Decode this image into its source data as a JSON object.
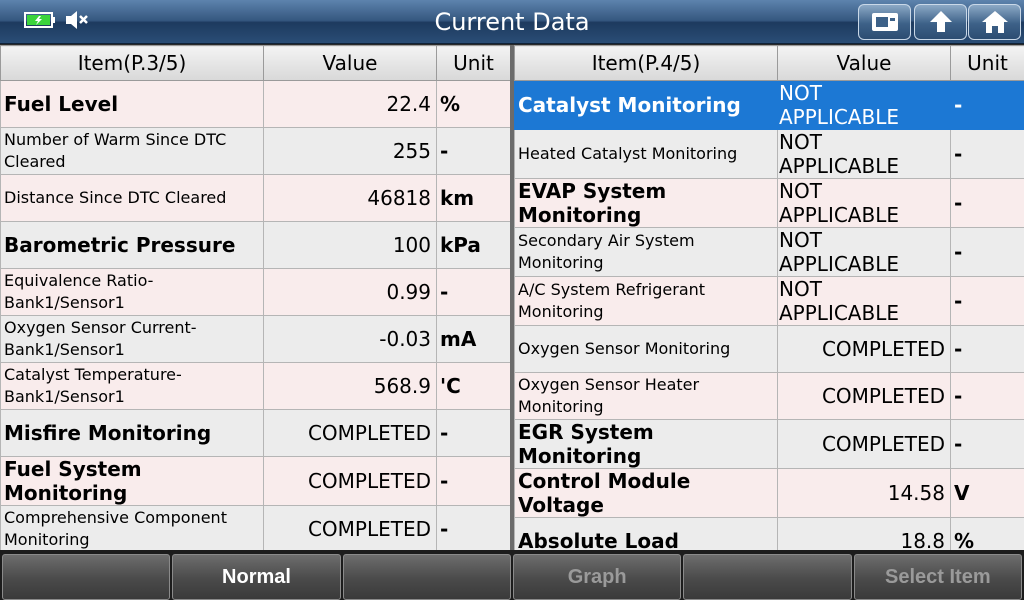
{
  "title": "Current Data",
  "left_table": {
    "headers": {
      "item": "Item(P.3/5)",
      "value": "Value",
      "unit": "Unit"
    },
    "rows": [
      {
        "item": "Fuel Level",
        "value": "22.4",
        "unit": "%",
        "style": "big"
      },
      {
        "item": "Number of Warm Since DTC Cleared",
        "value": "255",
        "unit": "-",
        "style": "small"
      },
      {
        "item": "Distance Since DTC Cleared",
        "value": "46818",
        "unit": "km",
        "style": "small"
      },
      {
        "item": "Barometric Pressure",
        "value": "100",
        "unit": "kPa",
        "style": "big"
      },
      {
        "item": "Equivalence Ratio-Bank1/Sensor1",
        "value": "0.99",
        "unit": "-",
        "style": "small"
      },
      {
        "item": "Oxygen Sensor Current-Bank1/Sensor1",
        "value": "-0.03",
        "unit": "mA",
        "style": "small"
      },
      {
        "item": "Catalyst Temperature-Bank1/Sensor1",
        "value": "568.9",
        "unit": "'C",
        "style": "small"
      },
      {
        "item": "Misfire Monitoring",
        "value": "COMPLETED",
        "unit": "-",
        "style": "big"
      },
      {
        "item": "Fuel System Monitoring",
        "value": "COMPLETED",
        "unit": "-",
        "style": "big"
      },
      {
        "item": "Comprehensive Component Monitoring",
        "value": "COMPLETED",
        "unit": "-",
        "style": "small"
      }
    ]
  },
  "right_table": {
    "headers": {
      "item": "Item(P.4/5)",
      "value": "Value",
      "unit": "Unit"
    },
    "rows": [
      {
        "item": "Catalyst Monitoring",
        "value": "NOT APPLICABLE",
        "unit": "-",
        "style": "big"
      },
      {
        "item": "Heated Catalyst Monitoring",
        "value": "NOT APPLICABLE",
        "unit": "-",
        "style": "small"
      },
      {
        "item": "EVAP System Monitoring",
        "value": "NOT APPLICABLE",
        "unit": "-",
        "style": "big"
      },
      {
        "item": "Secondary Air System Monitoring",
        "value": "NOT APPLICABLE",
        "unit": "-",
        "style": "small"
      },
      {
        "item": "A/C System Refrigerant Monitoring",
        "value": "NOT APPLICABLE",
        "unit": "-",
        "style": "small"
      },
      {
        "item": "Oxygen Sensor Monitoring",
        "value": "COMPLETED",
        "unit": "-",
        "style": "small"
      },
      {
        "item": "Oxygen Sensor Heater Monitoring",
        "value": "COMPLETED",
        "unit": "-",
        "style": "small"
      },
      {
        "item": "EGR System Monitoring",
        "value": "COMPLETED",
        "unit": "-",
        "style": "big"
      },
      {
        "item": "Control Module Voltage",
        "value": "14.58",
        "unit": "V",
        "style": "big"
      },
      {
        "item": "Absolute Load",
        "value": "18.8",
        "unit": "%",
        "style": "big"
      }
    ]
  },
  "bottom_buttons": [
    "",
    "Normal",
    "",
    "Graph",
    "",
    "Select Item"
  ],
  "colors": {
    "selected_row": "#1c78d4",
    "battery": "#3cd43c"
  },
  "icons": {
    "battery": "battery-charging-icon",
    "mute": "speaker-muted-icon",
    "save": "save-icon",
    "back": "up-arrow-icon",
    "home": "home-icon"
  }
}
